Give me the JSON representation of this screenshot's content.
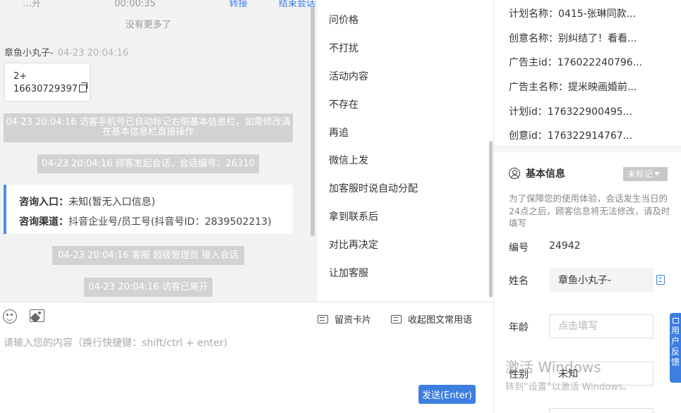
{
  "chat": {
    "top_cut": {
      "left": "…开",
      "time": "00:00:35",
      "link1": "转接",
      "link2": "结束会话"
    },
    "no_more": "没有更多了",
    "sender_name": "章鱼小丸子-",
    "sender_time": "04-23 20:04:16",
    "contact_card": {
      "line1": "2+",
      "line2": "16630729397"
    },
    "sys1": "04-23 20:04:16 访客手机号已自动标记右侧基本信息栏，如需修改请在基本信息栏直接操作",
    "sys2": "04-23 20:04:16 顾客发起会话，会话编号：26310",
    "entry": {
      "label1": "咨询入口：",
      "value1": "未知(暂无入口信息)",
      "label2": "咨询渠道：",
      "value2": "抖音企业号/员工号(抖音号ID：2839502213)"
    },
    "sys3": "04-23 20:04:16 客服 超级管理员 接入会话",
    "sys4": "04-23 20:04:16 访客已离开"
  },
  "tags": [
    "问价格",
    "不打扰",
    "活动内容",
    "不存在",
    "再追",
    "微信上发",
    "加客服时说自动分配",
    "拿到联系后",
    "对比再决定",
    "让加客服"
  ],
  "editor": {
    "card_btn": "留资卡片",
    "collapse_btn": "收起图文常用语",
    "placeholder": "请输入您的内容（换行快捷键：shift/ctrl + enter)",
    "send": "发送(Enter)"
  },
  "info": {
    "plan_rows": [
      "计划名称：0415-张琳同款...",
      "创意名称：别纠结了！看看...",
      "广告主id：176022240796...",
      "广告主名称：提米映画婚前...",
      "计划id：176322900495...",
      "创意id：176322914767..."
    ],
    "basic_title": "基本信息",
    "mark_badge": "未标记",
    "notice": "为了保障您的使用体验，会话发生当日的24点之后，顾客信息将无法修改，请及时填写",
    "id_label": "编号",
    "id_value": "24942",
    "name_label": "姓名",
    "name_value": "章鱼小丸子-",
    "age_label": "年龄",
    "age_placeholder": "点击填写",
    "gender_label": "性别",
    "gender_value": "未知",
    "feedback": "用户反馈"
  },
  "watermark": {
    "line1": "激活 Windows",
    "line2": "转到“设置”以激活 Windows。"
  },
  "colors": {
    "accent": "#3d7fe0",
    "system_bubble": "#d2d2d2",
    "chat_bg": "#f2f2f2"
  }
}
